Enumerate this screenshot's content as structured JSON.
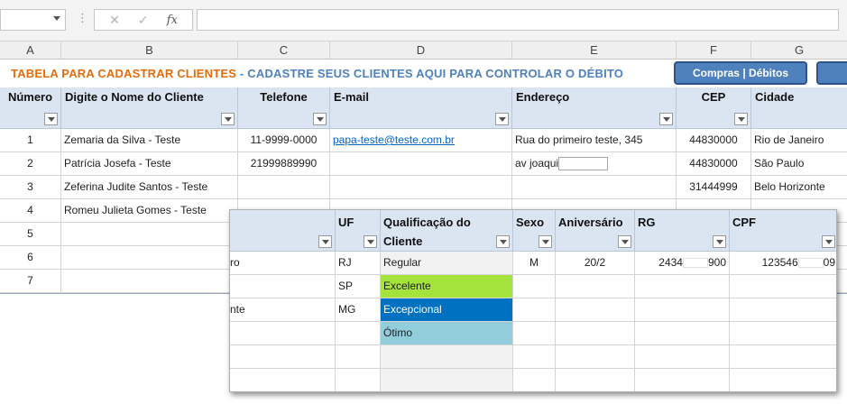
{
  "formula_bar": {
    "fx_label": "fx"
  },
  "columns": [
    "A",
    "B",
    "C",
    "D",
    "E",
    "F",
    "G"
  ],
  "title": {
    "part1": "TABELA PARA CADASTRAR CLIENTES",
    "part2": " - CADASTRE SEUS CLIENTES AQUI PARA CONTROLAR O DÉBITO"
  },
  "buttons": {
    "compras_debitos": "Compras | Débitos"
  },
  "headers": {
    "numero": "Número",
    "nome": "Digite o Nome do Cliente",
    "telefone": "Telefone",
    "email": "E-mail",
    "endereco": "Endereço",
    "cep": "CEP",
    "cidade": "Cidade"
  },
  "rows": [
    {
      "num": "1",
      "nome": "Zemaria da Silva - Teste",
      "telefone": "11-9999-0000",
      "email": "papa-teste@teste.com.br",
      "endereco": "Rua do primeiro  teste, 345",
      "cep": "44830000",
      "cidade": "Rio de Janeiro"
    },
    {
      "num": "2",
      "nome": "Patrícia Josefa - Teste",
      "telefone": "21999889990",
      "email": "",
      "endereco": "av joaqui",
      "cep": "44830000",
      "cidade": "São Paulo"
    },
    {
      "num": "3",
      "nome": "Zeferina Judite Santos - Teste",
      "telefone": "",
      "email": "",
      "endereco": "",
      "cep": "31444999",
      "cidade": "Belo Horizonte"
    },
    {
      "num": "4",
      "nome": "Romeu Julieta Gomes - Teste",
      "telefone": "",
      "email": "",
      "endereco": "",
      "cep": "",
      "cidade": ""
    },
    {
      "num": "5"
    },
    {
      "num": "6"
    },
    {
      "num": "7"
    }
  ],
  "panel": {
    "headers": {
      "uf": "UF",
      "qualificacao_l1": "Qualificação do",
      "qualificacao_l2": "Cliente",
      "sexo": "Sexo",
      "aniversario": "Aniversário",
      "rg": "RG",
      "cpf": "CPF"
    },
    "rows": [
      {
        "cidade_end": "ro",
        "uf": "RJ",
        "qual": "Regular",
        "sexo": "M",
        "aniv": "20/2",
        "rg_start": "2434",
        "rg_end": "900",
        "cpf_start": "123546",
        "cpf_end": "09"
      },
      {
        "cidade_end": "",
        "uf": "SP",
        "qual": "Excelente"
      },
      {
        "cidade_end": "nte",
        "uf": "MG",
        "qual": "Excepcional"
      },
      {
        "cidade_end": "",
        "uf": "",
        "qual": "Ótimo"
      }
    ],
    "qual_colors": {
      "excelente": "#a4e33c",
      "excepcional": "#0070c0",
      "otimo": "#92cddc"
    }
  }
}
